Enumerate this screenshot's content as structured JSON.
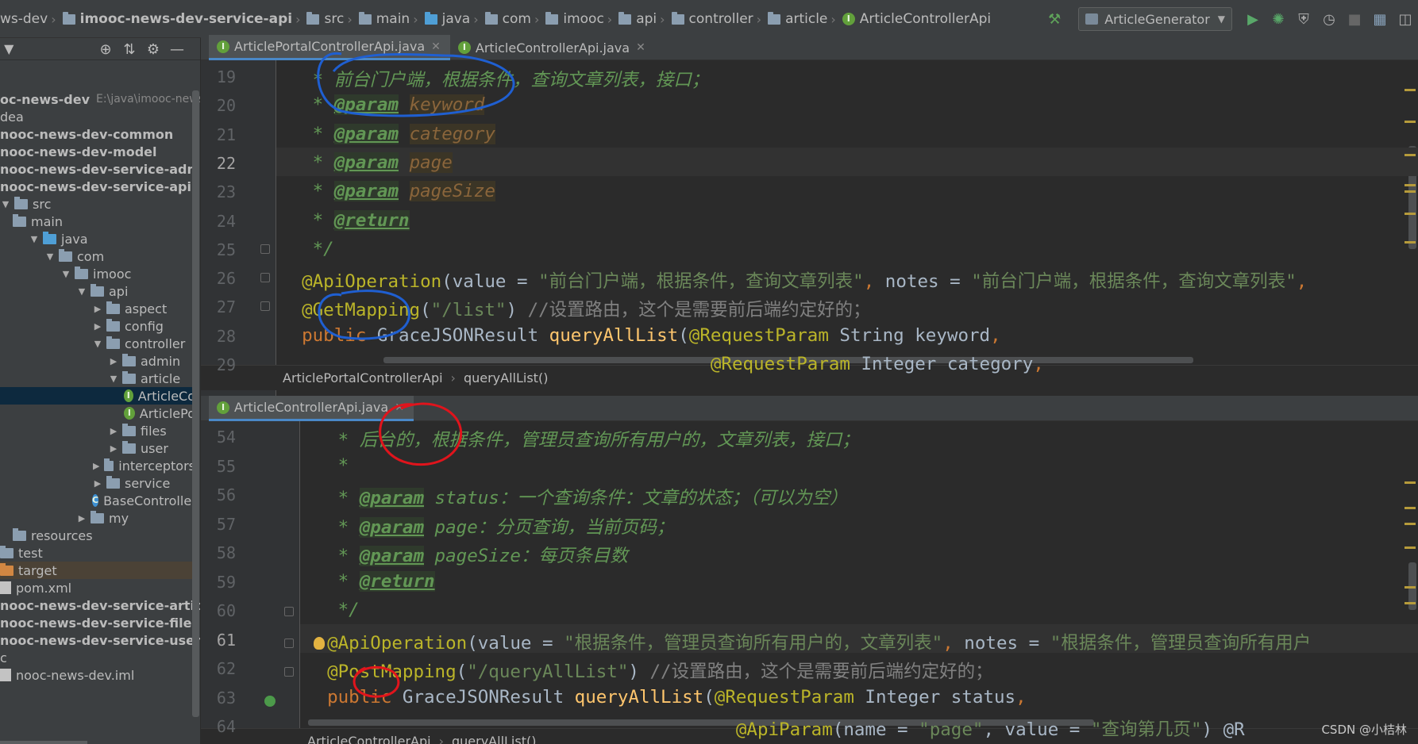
{
  "breadcrumbs": [
    {
      "label": "ws-dev",
      "icon": "none"
    },
    {
      "label": "imooc-news-dev-service-api",
      "icon": "folder-icon",
      "bold": true
    },
    {
      "label": "src",
      "icon": "folder-icon"
    },
    {
      "label": "main",
      "icon": "folder-icon"
    },
    {
      "label": "java",
      "icon": "source-folder-icon"
    },
    {
      "label": "com",
      "icon": "package-icon"
    },
    {
      "label": "imooc",
      "icon": "package-icon"
    },
    {
      "label": "api",
      "icon": "package-icon"
    },
    {
      "label": "controller",
      "icon": "package-icon"
    },
    {
      "label": "article",
      "icon": "package-icon"
    },
    {
      "label": "ArticleControllerApi",
      "icon": "interface-icon"
    }
  ],
  "toolbar": {
    "run_config": "ArticleGenerator",
    "icons": [
      "build-hammer-icon",
      "run-icon",
      "debug-icon",
      "coverage-icon",
      "profile-icon",
      "stop-icon",
      "project-structure-icon",
      "layout-icon"
    ]
  },
  "project_tree": [
    {
      "label": "oc-news-dev",
      "path_hint": "E:\\java\\imooc-news-d",
      "bold": true,
      "indent": 0,
      "kind": "module"
    },
    {
      "label": "dea",
      "indent": 0,
      "kind": "text"
    },
    {
      "label": "nooc-news-dev-common",
      "indent": 0,
      "bold": true,
      "kind": "module"
    },
    {
      "label": "nooc-news-dev-model",
      "indent": 0,
      "bold": true,
      "kind": "module"
    },
    {
      "label": "nooc-news-dev-service-admin",
      "indent": 0,
      "bold": true,
      "kind": "module"
    },
    {
      "label": "nooc-news-dev-service-api",
      "indent": 0,
      "bold": true,
      "kind": "module"
    },
    {
      "label": "src",
      "indent": 0,
      "kind": "folder",
      "arrow": "down"
    },
    {
      "label": "main",
      "indent": 1,
      "kind": "folder"
    },
    {
      "label": "java",
      "indent": 2,
      "kind": "source",
      "arrow": "down"
    },
    {
      "label": "com",
      "indent": 3,
      "kind": "folder",
      "arrow": "down"
    },
    {
      "label": "imooc",
      "indent": 4,
      "kind": "folder",
      "arrow": "down"
    },
    {
      "label": "api",
      "indent": 5,
      "kind": "folder",
      "arrow": "down"
    },
    {
      "label": "aspect",
      "indent": 6,
      "kind": "folder",
      "arrow": "right"
    },
    {
      "label": "config",
      "indent": 6,
      "kind": "folder",
      "arrow": "right"
    },
    {
      "label": "controller",
      "indent": 6,
      "kind": "folder",
      "arrow": "down"
    },
    {
      "label": "admin",
      "indent": 7,
      "kind": "folder",
      "arrow": "right"
    },
    {
      "label": "article",
      "indent": 7,
      "kind": "folder",
      "arrow": "down"
    },
    {
      "label": "ArticleCo",
      "indent": 8,
      "kind": "interface",
      "selected": true
    },
    {
      "label": "ArticlePo",
      "indent": 8,
      "kind": "interface"
    },
    {
      "label": "files",
      "indent": 7,
      "kind": "folder",
      "arrow": "right"
    },
    {
      "label": "user",
      "indent": 7,
      "kind": "folder",
      "arrow": "right"
    },
    {
      "label": "interceptors",
      "indent": 6,
      "kind": "folder",
      "arrow": "right"
    },
    {
      "label": "service",
      "indent": 6,
      "kind": "folder",
      "arrow": "right"
    },
    {
      "label": "BaseController",
      "indent": 6,
      "kind": "class"
    },
    {
      "label": "my",
      "indent": 5,
      "kind": "folder",
      "arrow": "right"
    },
    {
      "label": "resources",
      "indent": 1,
      "kind": "folder"
    },
    {
      "label": "test",
      "indent": 0,
      "kind": "folder"
    },
    {
      "label": "target",
      "indent": 0,
      "kind": "orange-folder",
      "highlight": true
    },
    {
      "label": "pom.xml",
      "indent": 0,
      "kind": "file"
    },
    {
      "label": "nooc-news-dev-service-article",
      "indent": 0,
      "bold": true,
      "kind": "module"
    },
    {
      "label": "nooc-news-dev-service-files",
      "indent": 0,
      "bold": true,
      "kind": "module"
    },
    {
      "label": "nooc-news-dev-service-user",
      "indent": 0,
      "bold": true,
      "kind": "module"
    },
    {
      "label": "c",
      "indent": 0,
      "kind": "text"
    },
    {
      "label": "nooc-news-dev.iml",
      "indent": 0,
      "kind": "file"
    }
  ],
  "pane_top": {
    "tabs": [
      {
        "label": "ArticlePortalControllerApi.java",
        "active": true
      },
      {
        "label": "ArticleControllerApi.java",
        "active": false
      }
    ],
    "lines": [
      {
        "no": "19",
        "segs": [
          [
            "c-doc",
            "   * 前台门户端，根据条件，查询文章列表，接口；"
          ]
        ]
      },
      {
        "no": "20",
        "segs": [
          [
            "c-doc",
            "   * "
          ],
          [
            "c-tag",
            "@param"
          ],
          [
            "c-doc",
            " "
          ],
          [
            "c-parm",
            "keyword"
          ]
        ]
      },
      {
        "no": "21",
        "segs": [
          [
            "c-doc",
            "   * "
          ],
          [
            "c-tag",
            "@param"
          ],
          [
            "c-doc",
            " "
          ],
          [
            "c-parm",
            "category"
          ]
        ]
      },
      {
        "no": "22",
        "segs": [
          [
            "c-doc",
            "   * "
          ],
          [
            "c-tag",
            "@param"
          ],
          [
            "c-doc",
            " "
          ],
          [
            "c-parm",
            "page"
          ]
        ],
        "current": true
      },
      {
        "no": "23",
        "segs": [
          [
            "c-doc",
            "   * "
          ],
          [
            "c-tag",
            "@param"
          ],
          [
            "c-doc",
            " "
          ],
          [
            "c-parm",
            "pageSize"
          ]
        ]
      },
      {
        "no": "24",
        "segs": [
          [
            "c-doc",
            "   * "
          ],
          [
            "c-tag",
            "@return"
          ]
        ]
      },
      {
        "no": "25",
        "segs": [
          [
            "c-doc",
            "   */"
          ]
        ]
      },
      {
        "no": "26",
        "segs": [
          [
            "c-ann",
            "  @ApiOperation"
          ],
          [
            "c-txt",
            "(value = "
          ],
          [
            "c-str",
            "\"前台门户端，根据条件，查询文章列表\""
          ],
          [
            "c-kw",
            ","
          ],
          [
            "c-txt",
            " notes = "
          ],
          [
            "c-str",
            "\"前台门户端，根据条件，查询文章列表\""
          ],
          [
            "c-kw",
            ","
          ]
        ]
      },
      {
        "no": "27",
        "segs": [
          [
            "c-ann",
            "  @GetMapping"
          ],
          [
            "c-txt",
            "("
          ],
          [
            "c-str",
            "\"/list\""
          ],
          [
            "c-txt",
            ") "
          ],
          [
            "c-cmt",
            "//设置路由，这个是需要前后端约定好的；"
          ]
        ]
      },
      {
        "no": "28",
        "segs": [
          [
            "c-kw",
            "  public "
          ],
          [
            "c-txt",
            "GraceJSONResult "
          ],
          [
            "c-fn",
            "queryAllList"
          ],
          [
            "c-txt",
            "("
          ],
          [
            "c-ann",
            "@RequestParam"
          ],
          [
            "c-txt",
            " String keyword"
          ],
          [
            "c-kw",
            ","
          ]
        ]
      },
      {
        "no": "29",
        "segs": [
          [
            "c-txt",
            "                                        "
          ],
          [
            "c-ann",
            "@RequestParam"
          ],
          [
            "c-txt",
            " Integer category"
          ],
          [
            "c-kw",
            ","
          ]
        ]
      }
    ],
    "crumbs": [
      "ArticlePortalControllerApi",
      "queryAllList()"
    ]
  },
  "pane_bottom": {
    "tabs": [
      {
        "label": "ArticleControllerApi.java",
        "active": true
      }
    ],
    "lines": [
      {
        "no": "54",
        "segs": [
          [
            "c-doc",
            "   * 后台的，根据条件，管理员查询所有用户的，文章列表，接口；"
          ]
        ]
      },
      {
        "no": "55",
        "segs": [
          [
            "c-doc",
            "   *"
          ]
        ]
      },
      {
        "no": "56",
        "segs": [
          [
            "c-doc",
            "   * "
          ],
          [
            "c-tag",
            "@param"
          ],
          [
            "c-doc",
            " status：一个查询条件：文章的状态；（可以为空）"
          ]
        ]
      },
      {
        "no": "57",
        "segs": [
          [
            "c-doc",
            "   * "
          ],
          [
            "c-tag",
            "@param"
          ],
          [
            "c-doc",
            " page：分页查询，当前页码；"
          ]
        ]
      },
      {
        "no": "58",
        "segs": [
          [
            "c-doc",
            "   * "
          ],
          [
            "c-tag",
            "@param"
          ],
          [
            "c-doc",
            " pageSize：每页条目数"
          ]
        ]
      },
      {
        "no": "59",
        "segs": [
          [
            "c-doc",
            "   * "
          ],
          [
            "c-tag",
            "@return"
          ]
        ]
      },
      {
        "no": "60",
        "segs": [
          [
            "c-doc",
            "   */"
          ]
        ]
      },
      {
        "no": "61",
        "segs": [
          [
            "c-ann",
            "  @ApiOperation"
          ],
          [
            "c-txt",
            "(value = "
          ],
          [
            "c-str",
            "\"根据条件，管理员查询所有用户的，文章列表\""
          ],
          [
            "c-kw",
            ","
          ],
          [
            "c-txt",
            " notes = "
          ],
          [
            "c-str",
            "\"根据条件，管理员查询所有用户"
          ]
        ],
        "current": true
      },
      {
        "no": "62",
        "segs": [
          [
            "c-ann",
            "  @PostMapping"
          ],
          [
            "c-txt",
            "("
          ],
          [
            "c-str",
            "\"/queryAllList\""
          ],
          [
            "c-txt",
            ") "
          ],
          [
            "c-cmt",
            "//设置路由，这个是需要前后端约定好的；"
          ]
        ]
      },
      {
        "no": "63",
        "segs": [
          [
            "c-kw",
            "  public "
          ],
          [
            "c-txt",
            "GraceJSONResult "
          ],
          [
            "c-fn",
            "queryAllList"
          ],
          [
            "c-txt",
            "("
          ],
          [
            "c-ann",
            "@RequestParam"
          ],
          [
            "c-txt",
            " Integer status"
          ],
          [
            "c-kw",
            ","
          ]
        ]
      },
      {
        "no": "64",
        "segs": [
          [
            "c-txt",
            "                                        "
          ],
          [
            "c-ann",
            "@ApiParam"
          ],
          [
            "c-txt",
            "(name = "
          ],
          [
            "c-str",
            "\"page\""
          ],
          [
            "c-txt",
            ", value = "
          ],
          [
            "c-str",
            "\"查询第几页\""
          ],
          [
            "c-txt",
            ") @R"
          ]
        ]
      }
    ],
    "crumbs": [
      "ArticleControllerApi",
      "queryAllList()"
    ]
  },
  "watermark": "CSDN @小桔林",
  "colors": {
    "annotation_blue": "#1f5fd1",
    "annotation_red": "#e0141c",
    "editor_bg": "#2b2b2b",
    "panel_bg": "#3c3f41"
  }
}
